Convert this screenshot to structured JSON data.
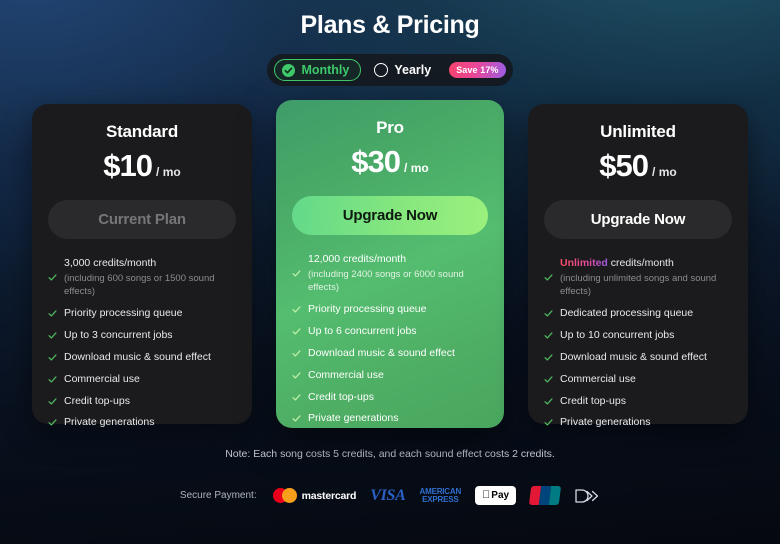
{
  "header": {
    "title": "Plans & Pricing"
  },
  "billing_toggle": {
    "monthly_label": "Monthly",
    "yearly_label": "Yearly",
    "save_badge": "Save 17%",
    "selected": "Monthly"
  },
  "plans": [
    {
      "name": "Standard",
      "price": "$10",
      "period": "/ mo",
      "cta_label": "Current Plan",
      "cta_state": "current",
      "features": [
        {
          "text": "3,000 credits/month",
          "sub": "(including 600 songs or 1500 sound effects)"
        },
        {
          "text": "Priority processing queue"
        },
        {
          "text": "Up to 3 concurrent jobs"
        },
        {
          "text": "Download music & sound effect"
        },
        {
          "text": "Commercial use"
        },
        {
          "text": "Credit top-ups"
        },
        {
          "text": "Private generations"
        }
      ]
    },
    {
      "name": "Pro",
      "price": "$30",
      "period": "/ mo",
      "cta_label": "Upgrade Now",
      "cta_state": "upgrade-featured",
      "features": [
        {
          "text": "12,000 credits/month",
          "sub": "(including 2400 songs or 6000 sound effects)"
        },
        {
          "text": "Priority processing queue"
        },
        {
          "text": "Up to 6 concurrent jobs"
        },
        {
          "text": "Download music & sound effect"
        },
        {
          "text": "Commercial use"
        },
        {
          "text": "Credit top-ups"
        },
        {
          "text": "Private generations"
        }
      ]
    },
    {
      "name": "Unlimited",
      "price": "$50",
      "period": "/ mo",
      "cta_label": "Upgrade Now",
      "cta_state": "upgrade",
      "features": [
        {
          "highlight": "Unlimited",
          "text": " credits/month",
          "sub": "(including unlimited songs and sound effects)"
        },
        {
          "text": "Dedicated processing queue"
        },
        {
          "text": "Up to 10 concurrent jobs"
        },
        {
          "text": "Download music & sound effect"
        },
        {
          "text": "Commercial use"
        },
        {
          "text": "Credit top-ups"
        },
        {
          "text": "Private generations"
        }
      ]
    }
  ],
  "note": "Note: Each song costs 5 credits, and each sound effect costs 2 credits.",
  "payments": {
    "label": "Secure Payment:",
    "methods": [
      {
        "id": "mastercard",
        "label": "mastercard"
      },
      {
        "id": "visa",
        "label": "VISA"
      },
      {
        "id": "amex",
        "line1": "AMERICAN",
        "line2": "EXPRESS"
      },
      {
        "id": "applepay",
        "label": "Pay"
      },
      {
        "id": "unionpay",
        "label": "UnionPay"
      },
      {
        "id": "discover",
        "label": "Discover"
      }
    ]
  },
  "colors": {
    "accent_green": "#3ec96b",
    "featured_card": "#4eae64",
    "cta_light": "#86e77e",
    "badge_pink": "#f7436e",
    "badge_purple": "#9b5ce6",
    "card_dark": "#1b1b1d"
  }
}
